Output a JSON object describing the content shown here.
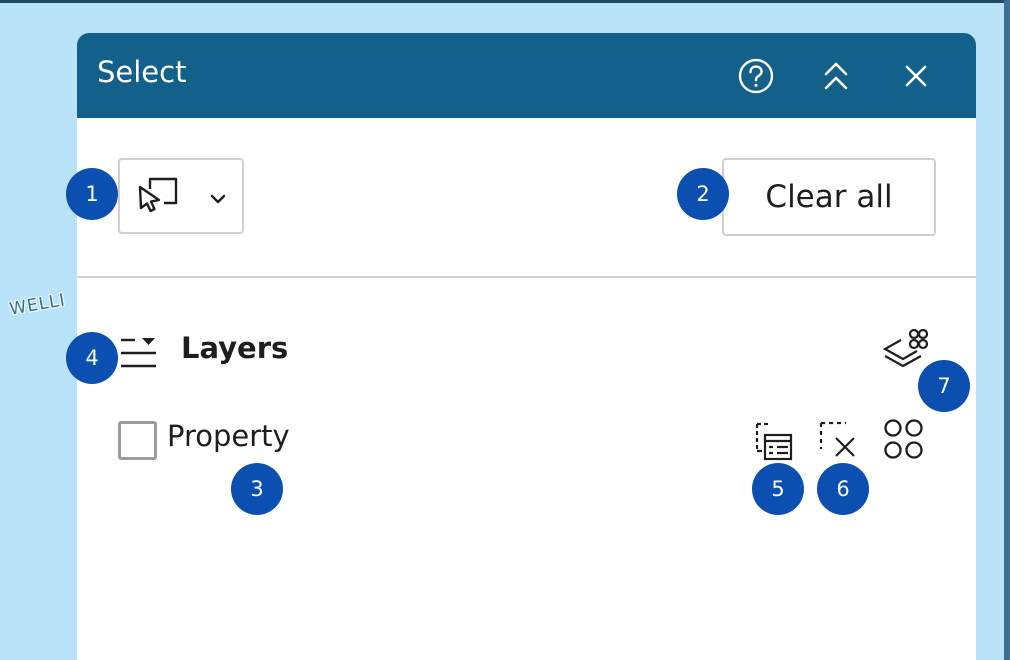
{
  "panel": {
    "title": "Select",
    "header_icons": [
      "help-icon",
      "collapse-icon",
      "close-icon"
    ]
  },
  "toolbar": {
    "selection_tool_icon": "rectangle-select-icon",
    "dropdown_icon": "chevron-down-icon",
    "clear_label": "Clear all"
  },
  "layers": {
    "title": "Layers",
    "heading_icon": "layer-list-icon",
    "action_icon": "select-layers-icon",
    "items": [
      {
        "label": "Property",
        "checked": false,
        "action_icons": [
          "show-table-icon",
          "clear-selection-icon",
          "more-options-icon"
        ]
      }
    ]
  },
  "map": {
    "visible_label": "WELLI"
  },
  "callouts": [
    "1",
    "2",
    "3",
    "4",
    "5",
    "6",
    "7"
  ],
  "colors": {
    "header": "#13618a",
    "map_background": "#b8e3f8",
    "callout": "#0b4fb0",
    "panel": "#ffffff"
  }
}
